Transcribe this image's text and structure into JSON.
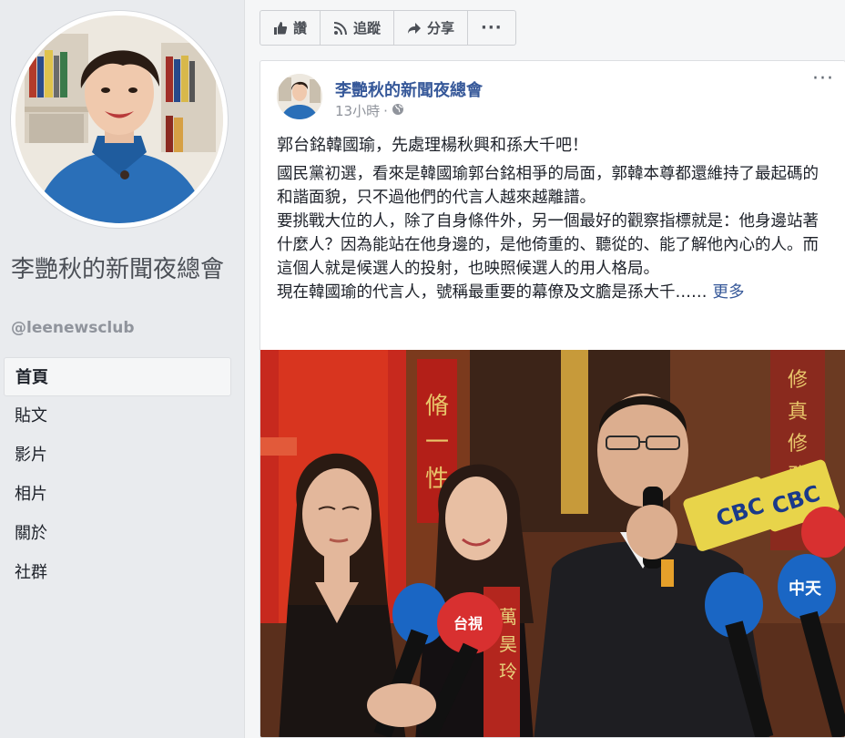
{
  "page": {
    "name": "李艷秋的新聞夜總會",
    "handle": "@leenewsclub"
  },
  "nav": {
    "items": [
      {
        "label": "首頁",
        "active": true
      },
      {
        "label": "貼文"
      },
      {
        "label": "影片"
      },
      {
        "label": "相片"
      },
      {
        "label": "關於"
      },
      {
        "label": "社群"
      }
    ]
  },
  "actions": {
    "like": "讚",
    "follow": "追蹤",
    "share": "分享",
    "more": "···"
  },
  "post": {
    "author": "李艷秋的新聞夜總會",
    "time": "13小時",
    "separator": "·",
    "privacy_icon": "globe-icon",
    "headline": "郭台銘韓國瑜，先處理楊秋興和孫大千吧！",
    "paragraphs": [
      "國民黨初選，看來是韓國瑜郭台銘相爭的局面，郭韓本尊都還維持了最起碼的和諧面貌，只不過他們的代言人越來越離譜。",
      "要挑戰大位的人，除了自身條件外，另一個最好的觀察指標就是：他身邊站著什麼人？因為能站在他身邊的，是他倚重的、聽從的、能了解他內心的人。而這個人就是候選人的投射，也映照候選人的用人格局。",
      "現在韓國瑜的代言人，號稱最重要的幕僚及文膽是孫大千……"
    ],
    "see_more": "更多",
    "more_icon": "···"
  },
  "photo": {
    "sign_left": "脩一性",
    "sign_right": "修真修雅",
    "mic_cbc": "CBC",
    "mic_tv": "台視",
    "mic_ct": "中天",
    "sash": "萬昊玲"
  },
  "colors": {
    "link": "#365899",
    "bg": "#e9ebee",
    "text": "#1d2129",
    "muted": "#90949c"
  }
}
